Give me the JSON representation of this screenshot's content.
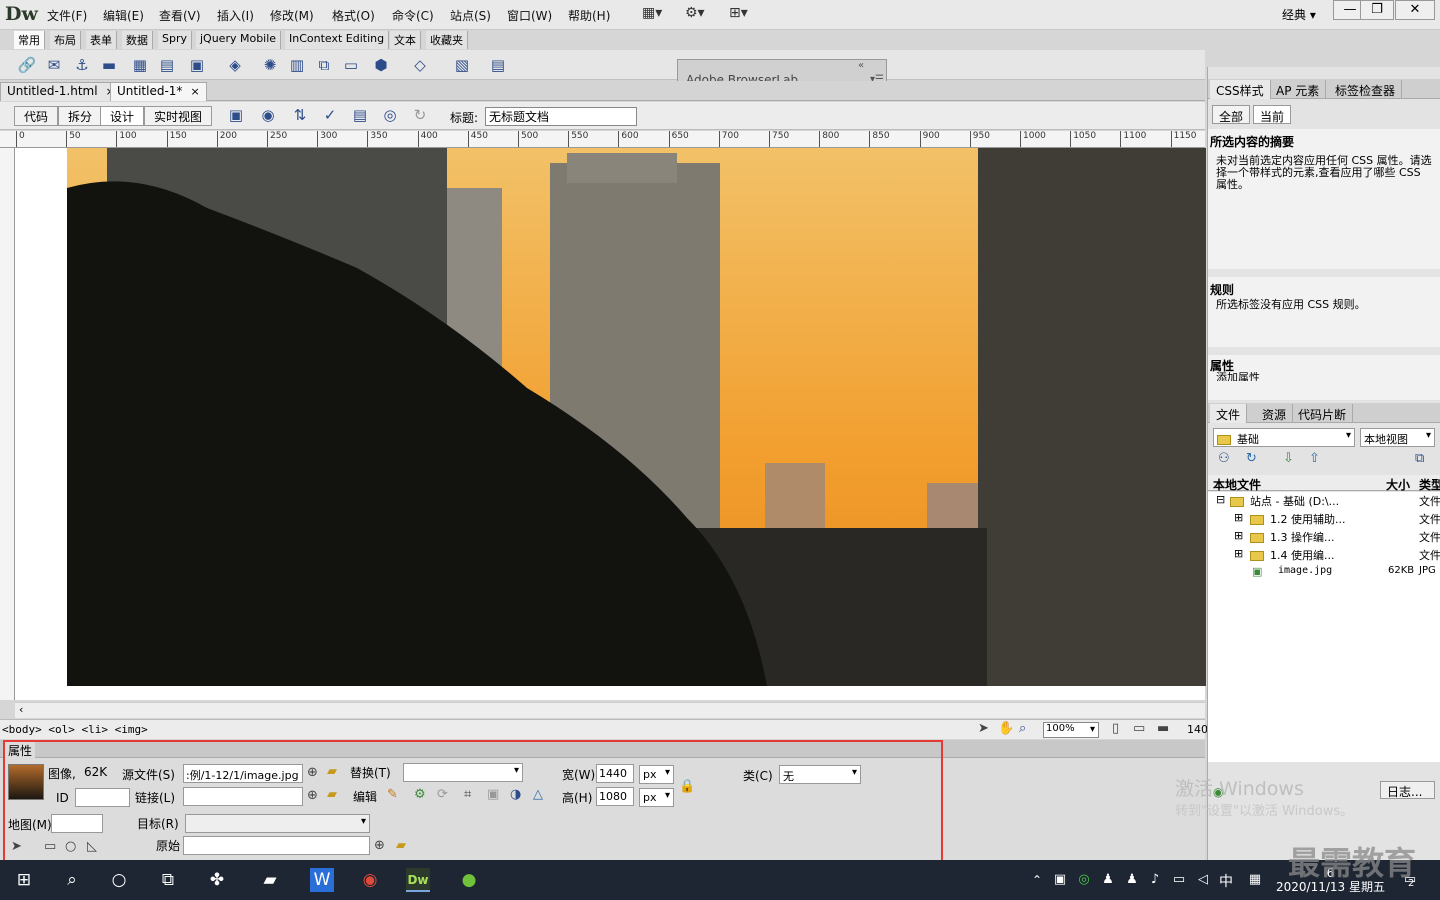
{
  "app": {
    "logo": "Dw",
    "menu": [
      "文件(F)",
      "编辑(E)",
      "查看(V)",
      "插入(I)",
      "修改(M)",
      "格式(O)",
      "命令(C)",
      "站点(S)",
      "窗口(W)",
      "帮助(H)"
    ],
    "workspace": "经典",
    "window_buttons": [
      "—",
      "❐",
      "✕"
    ]
  },
  "insert_tabs": [
    "常用",
    "布局",
    "表单",
    "数据",
    "Spry",
    "jQuery Mobile",
    "InContext Editing",
    "文本",
    "收藏夹"
  ],
  "insert_active": "常用",
  "browserlab": "Adobe BrowserLab",
  "doc_tabs": [
    {
      "label": "Untitled-1.html",
      "close": "×"
    },
    {
      "label": "Untitled-1*",
      "close": "×"
    }
  ],
  "view_buttons": [
    "代码",
    "拆分",
    "设计",
    "实时视图"
  ],
  "view_active": "设计",
  "title_label": "标题:",
  "title_value": "无标题文档",
  "ruler_marks": [
    "0",
    "50",
    "100",
    "150",
    "200",
    "250",
    "300",
    "350",
    "400",
    "450",
    "500",
    "550",
    "600",
    "650",
    "700",
    "750",
    "800",
    "850",
    "900",
    "950",
    "1000",
    "1050",
    "1100",
    "1150"
  ],
  "status": {
    "tag_selector": "<body> <ol> <li> <img>",
    "zoom": "100%",
    "size": "140"
  },
  "properties": {
    "tab": "属性",
    "image_label": "图像,",
    "image_size": "62K",
    "src_label": "源文件(S)",
    "src_value": ":例/1-12/1/image.jpg",
    "alt_label": "替换(T)",
    "width_label": "宽(W)",
    "width_value": "1440",
    "height_label": "高(H)",
    "height_value": "1080",
    "unit": "px",
    "class_label": "类(C)",
    "class_value": "无",
    "id_label": "ID",
    "link_label": "链接(L)",
    "edit_label": "编辑",
    "map_label": "地图(M)",
    "target_label": "目标(R)",
    "original_label": "原始"
  },
  "css_panel": {
    "tabs": [
      "CSS样式",
      "AP 元素",
      "标签检查器"
    ],
    "subtabs": [
      "全部",
      "当前"
    ],
    "summary_title": "所选内容的摘要",
    "summary_text": "未对当前选定内容应用任何 CSS 属性。请选择一个带样式的元素,查看应用了哪些 CSS 属性。",
    "rules_title": "规则",
    "rules_text": "所选标签没有应用 CSS 规则。",
    "props_title": "属性",
    "props_add": "添加属性"
  },
  "files_panel": {
    "tabs": [
      "文件",
      "资源",
      "代码片断"
    ],
    "site": "基础",
    "view": "本地视图",
    "columns": [
      "本地文件",
      "大小",
      "类型"
    ],
    "rows": [
      {
        "name": "站点 - 基础 (D:\\...",
        "size": "",
        "type": "文件"
      },
      {
        "name": "1.2 使用辅助...",
        "size": "",
        "type": "文件"
      },
      {
        "name": "1.3 操作编...",
        "size": "",
        "type": "文件"
      },
      {
        "name": "1.4 使用编...",
        "size": "",
        "type": "文件"
      },
      {
        "name": "image.jpg",
        "size": "62KB",
        "type": "JPG"
      }
    ],
    "log": "日志..."
  },
  "watermark": {
    "line1": "激活 Windows",
    "line2": "转到\"设置\"以激活 Windows。"
  },
  "brand": "最需教育",
  "taskbar": {
    "ime": "中",
    "time": "6",
    "date": "2020/11/13 星期五",
    "badge": "2"
  }
}
